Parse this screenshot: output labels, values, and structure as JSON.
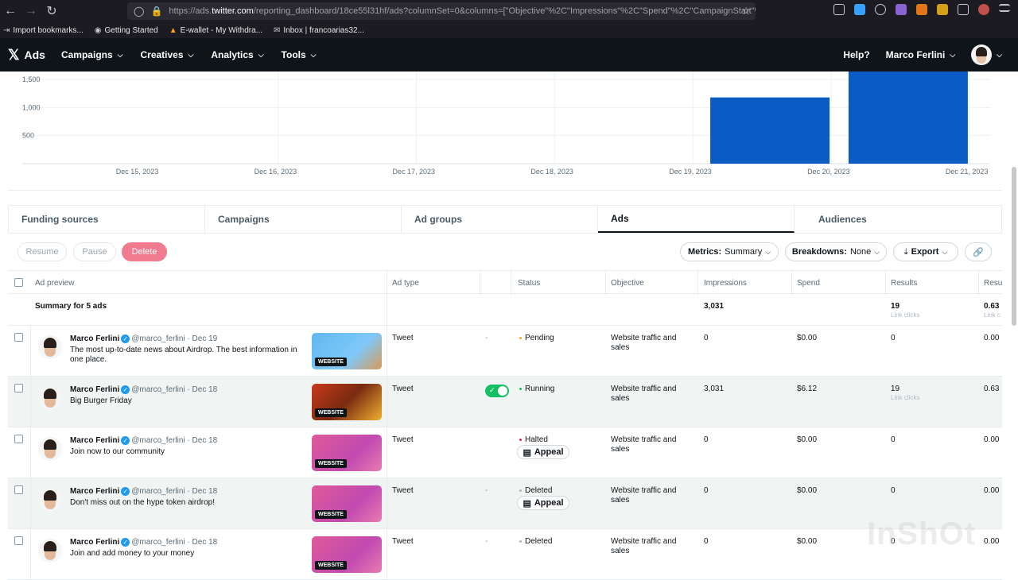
{
  "browser": {
    "url_prefix": "https://ads.",
    "url_domain": "twitter.com",
    "url_rest": "/reporting_dashboard/18ce55l31hf/ads?columnSet=0&columns=[\"Objective\"%2C\"Impressions\"%2C\"Spend\"%2C\"CampaignStart\"%2C\"Ca",
    "bookmarks": [
      "Import bookmarks...",
      "Getting Started",
      "E-wallet - My Withdra...",
      "Inbox | francoarias32..."
    ]
  },
  "header": {
    "logo": "Ads",
    "menu": [
      "Campaigns",
      "Creatives",
      "Analytics",
      "Tools"
    ],
    "help": "Help?",
    "user": "Marco Ferlini"
  },
  "chart_data": {
    "type": "bar",
    "categories": [
      "Dec 15, 2023",
      "Dec 16, 2023",
      "Dec 17, 2023",
      "Dec 18, 2023",
      "Dec 19, 2023",
      "Dec 20, 2023",
      "Dec 21, 2023"
    ],
    "bars": [
      {
        "x": "Dec 20, 2023",
        "value": 1180
      },
      {
        "x": "Dec 21, 2023",
        "value": 1851
      }
    ],
    "yticks": [
      "1,500",
      "1,000",
      "500"
    ],
    "ylim": [
      0,
      1500
    ],
    "color": "#0b5bc4",
    "grid": true
  },
  "tabs": [
    "Funding sources",
    "Campaigns",
    "Ad groups",
    "Ads",
    "Audiences"
  ],
  "actions": {
    "resume": "Resume",
    "pause": "Pause",
    "delete": "Delete",
    "metrics_label": "Metrics:",
    "metrics_value": "Summary",
    "breakdowns_label": "Breakdowns:",
    "breakdowns_value": "None",
    "export": "Export"
  },
  "table": {
    "headers": [
      "Ad preview",
      "Ad type",
      "Status",
      "Objective",
      "Impressions",
      "Spend",
      "Results",
      "Resu"
    ],
    "summary": {
      "label": "Summary for 5 ads",
      "impressions": "3,031",
      "results": "19",
      "results_sub": "Link clicks",
      "last": "0.63",
      "last_sub": "Link c"
    },
    "rows": [
      {
        "name": "Marco Ferlini",
        "meta": "@marco_ferlini · Dec 19",
        "text": "The most up-to-date news about Airdrop. The best information in one place.",
        "badge": "WEBSITE",
        "type": "Tweet",
        "toggle": "-",
        "status": "Pending",
        "status_color": "#f5a623",
        "objective": "Website traffic and sales",
        "impressions": "0",
        "spend": "$0.00",
        "results": "0",
        "results_sub": "",
        "last": "0.00",
        "appeal": ""
      },
      {
        "name": "Marco Ferlini",
        "meta": "@marco_ferlini · Dec 18",
        "text": "Big Burger Friday",
        "badge": "WEBSITE",
        "type": "Tweet",
        "toggle": "",
        "status": "Running",
        "status_color": "#17bf63",
        "objective": "Website traffic and sales",
        "impressions": "3,031",
        "spend": "$6.12",
        "results": "19",
        "results_sub": "Link clicks",
        "last": "0.63",
        "appeal": ""
      },
      {
        "name": "Marco Ferlini",
        "meta": "@marco_ferlini · Dec 18",
        "text": "Join now to our community",
        "badge": "WEBSITE",
        "type": "Tweet",
        "toggle": "",
        "status": "Halted",
        "status_color": "#e0245e",
        "objective": "Website traffic and sales",
        "impressions": "0",
        "spend": "$0.00",
        "results": "0",
        "results_sub": "",
        "last": "0.00",
        "appeal": "Appeal"
      },
      {
        "name": "Marco Ferlini",
        "meta": "@marco_ferlini · Dec 18",
        "text": "Don't miss out on the hype token airdrop!",
        "badge": "WEBSITE",
        "type": "Tweet",
        "toggle": "-",
        "status": "Deleted",
        "status_color": "#aab8c2",
        "objective": "Website traffic and sales",
        "impressions": "0",
        "spend": "$0.00",
        "results": "0",
        "results_sub": "",
        "last": "0.00",
        "appeal": "Appeal"
      },
      {
        "name": "Marco Ferlini",
        "meta": "@marco_ferlini · Dec 18",
        "text": "Join and add money to your money",
        "badge": "WEBSITE",
        "type": "Tweet",
        "toggle": "-",
        "status": "Deleted",
        "status_color": "#aab8c2",
        "objective": "Website traffic and sales",
        "impressions": "0",
        "spend": "$0.00",
        "results": "0",
        "results_sub": "",
        "last": "0.00",
        "appeal": ""
      }
    ]
  },
  "watermark": "InShOt"
}
